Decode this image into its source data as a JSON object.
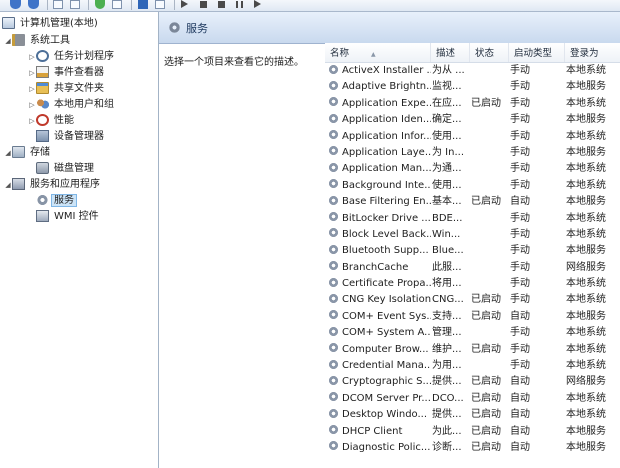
{
  "tree": {
    "root": "计算机管理(本地)",
    "items": [
      {
        "label": "系统工具",
        "icon": "tools-icon",
        "level": 1,
        "expanded": true
      },
      {
        "label": "任务计划程序",
        "icon": "clock-icon",
        "level": 2
      },
      {
        "label": "事件查看器",
        "icon": "event-log-icon",
        "level": 2
      },
      {
        "label": "共享文件夹",
        "icon": "shared-folder-icon",
        "level": 2
      },
      {
        "label": "本地用户和组",
        "icon": "users-icon",
        "level": 2
      },
      {
        "label": "性能",
        "icon": "performance-icon",
        "level": 2
      },
      {
        "label": "设备管理器",
        "icon": "device-manager-icon",
        "level": 2
      },
      {
        "label": "存储",
        "icon": "storage-icon",
        "level": 1,
        "expanded": true
      },
      {
        "label": "磁盘管理",
        "icon": "disk-icon",
        "level": 2
      },
      {
        "label": "服务和应用程序",
        "icon": "services-apps-icon",
        "level": 1,
        "expanded": true
      },
      {
        "label": "服务",
        "icon": "gear-icon",
        "level": 2,
        "selected": true
      },
      {
        "label": "WMI 控件",
        "icon": "wmi-icon",
        "level": 2
      }
    ]
  },
  "panel": {
    "title": "服务",
    "description": "选择一个项目来查看它的描述。"
  },
  "columns": {
    "name": "名称",
    "desc": "描述",
    "status": "状态",
    "startup": "启动类型",
    "logon": "登录为"
  },
  "services": [
    {
      "name": "ActiveX Installer ...",
      "desc": "为从 ...",
      "status": "",
      "startup": "手动",
      "logon": "本地系统"
    },
    {
      "name": "Adaptive Brightn...",
      "desc": "监视...",
      "status": "",
      "startup": "手动",
      "logon": "本地服务"
    },
    {
      "name": "Application Expe...",
      "desc": "在应...",
      "status": "已启动",
      "startup": "手动",
      "logon": "本地系统"
    },
    {
      "name": "Application Iden...",
      "desc": "确定...",
      "status": "",
      "startup": "手动",
      "logon": "本地服务"
    },
    {
      "name": "Application Infor...",
      "desc": "使用...",
      "status": "",
      "startup": "手动",
      "logon": "本地系统"
    },
    {
      "name": "Application Laye...",
      "desc": "为 In...",
      "status": "",
      "startup": "手动",
      "logon": "本地服务"
    },
    {
      "name": "Application Man...",
      "desc": "为通...",
      "status": "",
      "startup": "手动",
      "logon": "本地系统"
    },
    {
      "name": "Background Inte...",
      "desc": "使用...",
      "status": "",
      "startup": "手动",
      "logon": "本地系统"
    },
    {
      "name": "Base Filtering En...",
      "desc": "基本...",
      "status": "已启动",
      "startup": "自动",
      "logon": "本地服务"
    },
    {
      "name": "BitLocker Drive ...",
      "desc": "BDE...",
      "status": "",
      "startup": "手动",
      "logon": "本地系统"
    },
    {
      "name": "Block Level Back...",
      "desc": "Win...",
      "status": "",
      "startup": "手动",
      "logon": "本地系统"
    },
    {
      "name": "Bluetooth Supp...",
      "desc": "Blue...",
      "status": "",
      "startup": "手动",
      "logon": "本地服务"
    },
    {
      "name": "BranchCache",
      "desc": "此服...",
      "status": "",
      "startup": "手动",
      "logon": "网络服务"
    },
    {
      "name": "Certificate Propa...",
      "desc": "将用...",
      "status": "",
      "startup": "手动",
      "logon": "本地系统"
    },
    {
      "name": "CNG Key Isolation",
      "desc": "CNG...",
      "status": "已启动",
      "startup": "手动",
      "logon": "本地系统"
    },
    {
      "name": "COM+ Event Sys...",
      "desc": "支持...",
      "status": "已启动",
      "startup": "自动",
      "logon": "本地服务"
    },
    {
      "name": "COM+ System A...",
      "desc": "管理...",
      "status": "",
      "startup": "手动",
      "logon": "本地系统"
    },
    {
      "name": "Computer Brow...",
      "desc": "维护...",
      "status": "已启动",
      "startup": "手动",
      "logon": "本地系统"
    },
    {
      "name": "Credential Mana...",
      "desc": "为用...",
      "status": "",
      "startup": "手动",
      "logon": "本地系统"
    },
    {
      "name": "Cryptographic S...",
      "desc": "提供...",
      "status": "已启动",
      "startup": "自动",
      "logon": "网络服务"
    },
    {
      "name": "DCOM Server Pr...",
      "desc": "DCO...",
      "status": "已启动",
      "startup": "自动",
      "logon": "本地系统"
    },
    {
      "name": "Desktop Windo...",
      "desc": "提供...",
      "status": "已启动",
      "startup": "自动",
      "logon": "本地系统"
    },
    {
      "name": "DHCP Client",
      "desc": "为此...",
      "status": "已启动",
      "startup": "自动",
      "logon": "本地服务"
    },
    {
      "name": "Diagnostic Polic...",
      "desc": "诊断...",
      "status": "已启动",
      "startup": "自动",
      "logon": "本地服务"
    }
  ]
}
